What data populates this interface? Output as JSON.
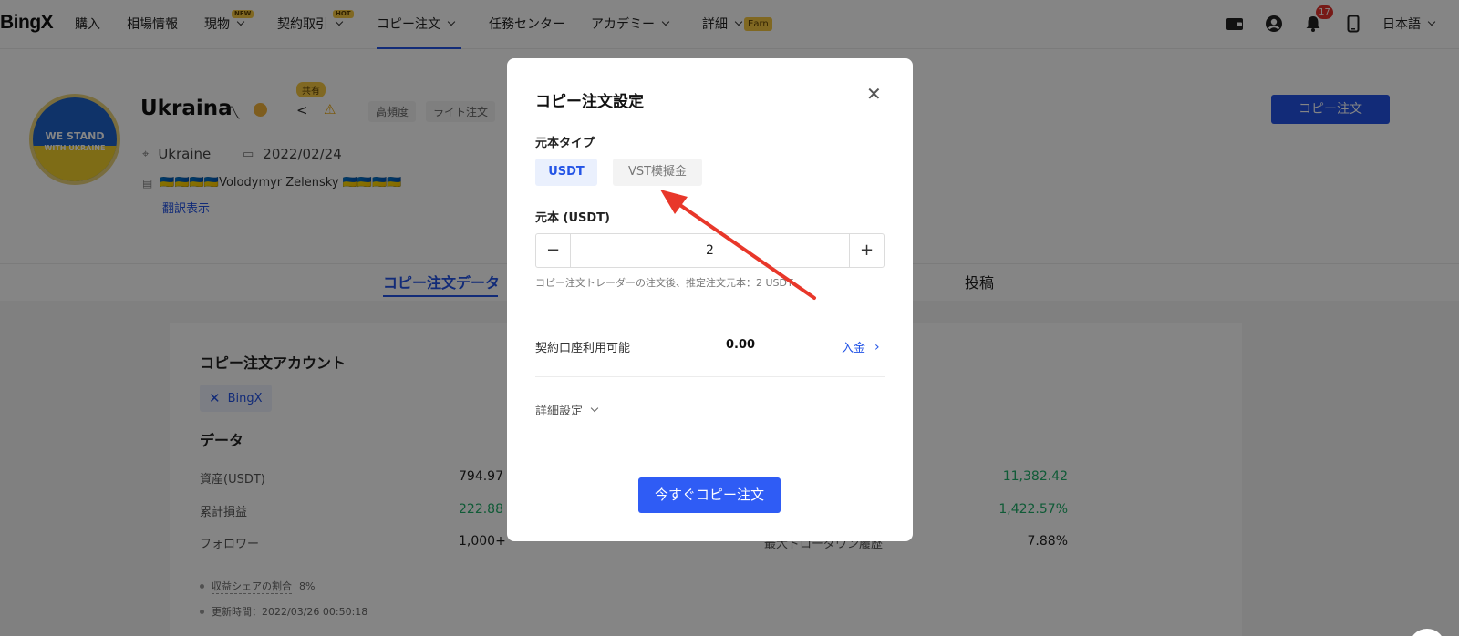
{
  "nav": {
    "logo": "BingX",
    "items": [
      {
        "label": "購入"
      },
      {
        "label": "相場情報"
      },
      {
        "label": "現物",
        "tag": "NEW"
      },
      {
        "label": "契約取引",
        "tag": "HOT"
      },
      {
        "label": "コピー注文"
      },
      {
        "label": "任務センター"
      },
      {
        "label": "アカデミー"
      },
      {
        "label": "詳細",
        "earn": "Earn"
      }
    ],
    "notification_count": "17",
    "language": "日本語",
    "icons": [
      "wallet-icon",
      "user-icon",
      "bell-icon",
      "phone-icon"
    ],
    "accent": "#2354e6"
  },
  "profile": {
    "name": "Ukraina",
    "name_symbol": "〽",
    "share_label": "共有",
    "chips": [
      "高頻度",
      "ライト注文"
    ],
    "country": "Ukraine",
    "join_date": "2022/02/24",
    "bio": "🇺🇦🇺🇦🇺🇦🇺🇦Volodymyr Zelensky 🇺🇦🇺🇦🇺🇦🇺🇦",
    "translate_link": "翻訳表示",
    "copy_button": "コピー注文",
    "avatar_text_1": "WE STAND",
    "avatar_text_2": "WITH UKRAINE"
  },
  "tabs": {
    "copy_data": "コピー注文データ",
    "posts": "投稿"
  },
  "main": {
    "account_title": "コピー注文アカウント",
    "account_chip": "BingX",
    "data_title": "データ",
    "rows": [
      {
        "label": "資産(USDT)",
        "value": "794.97",
        "right_label": "",
        "right_value": "11,382.42"
      },
      {
        "label": "累計損益",
        "value": "222.88",
        "right_label": "",
        "right_value": "1,422.57%"
      },
      {
        "label": "フォロワー",
        "value": "1,000+",
        "right_label": "最大ドローダウン履歴",
        "right_value": "7.88%"
      }
    ],
    "profit_share_label": "収益シェアの割合",
    "profit_share_value": "8%",
    "update_time": "更新時間：2022/03/26 00:50:18",
    "green": "#1fae6a"
  },
  "modal": {
    "title": "コピー注文設定",
    "principal_type_label": "元本タイプ",
    "type_usdt": "USDT",
    "type_vst": "VST模擬金",
    "principal_label": "元本 (USDT)",
    "principal_value": "2",
    "minus": "−",
    "plus": "+",
    "hint": "コピー注文トレーダーの注文後、推定注文元本：2 USDT",
    "available_label": "契約口座利用可能",
    "available_value": "0.00",
    "deposit_link": "入金",
    "advanced_label": "詳細設定",
    "submit_button": "今すぐコピー注文",
    "submit_color": "#2f5cf5",
    "annotation_arrow_color": "#e8372a"
  }
}
